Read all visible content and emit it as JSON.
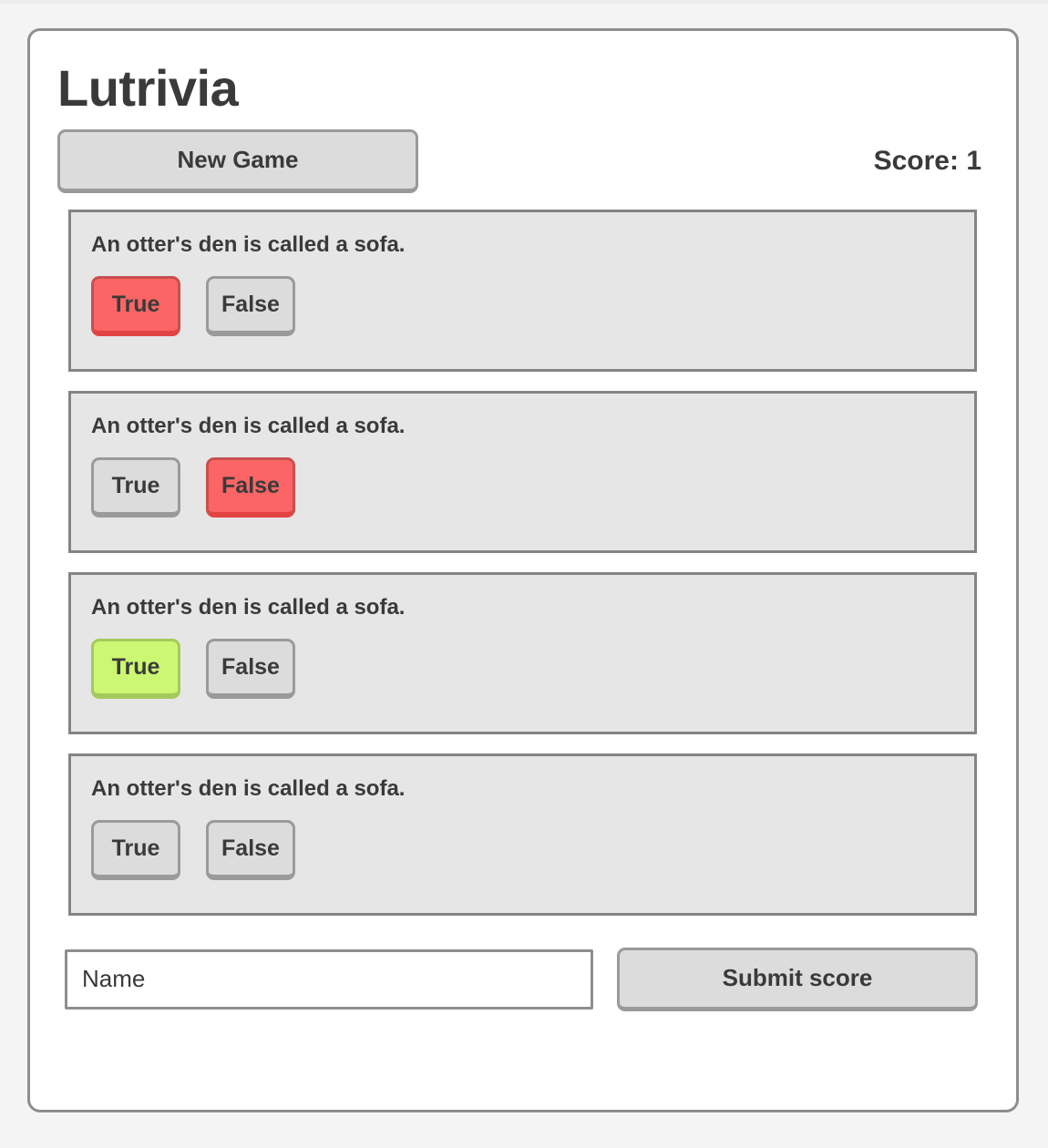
{
  "app": {
    "title": "Lutrivia"
  },
  "toolbar": {
    "new_game_label": "New Game",
    "score_label": "Score: 1"
  },
  "questions": [
    {
      "text": "An otter's den is called a sofa.",
      "true_label": "True",
      "false_label": "False",
      "selected": "True",
      "state": "incorrect"
    },
    {
      "text": "An otter's den is called a sofa.",
      "true_label": "True",
      "false_label": "False",
      "selected": "False",
      "state": "incorrect"
    },
    {
      "text": "An otter's den is called a sofa.",
      "true_label": "True",
      "false_label": "False",
      "selected": "True",
      "state": "correct"
    },
    {
      "text": "An otter's den is called a sofa.",
      "true_label": "True",
      "false_label": "False",
      "selected": null,
      "state": "unanswered"
    }
  ],
  "submit": {
    "name_placeholder": "Name",
    "name_value": "",
    "submit_label": "Submit score"
  },
  "colors": {
    "page_background": "#f4f4f4",
    "card_background": "#ffffff",
    "card_border": "#8e8e8e",
    "question_background": "#e6e6e6",
    "question_border": "#848484",
    "button_background": "#dcdcdc",
    "button_border": "#9a9a9a",
    "incorrect": "#fb6565",
    "correct": "#ccf772",
    "text": "#3a3a3a"
  }
}
